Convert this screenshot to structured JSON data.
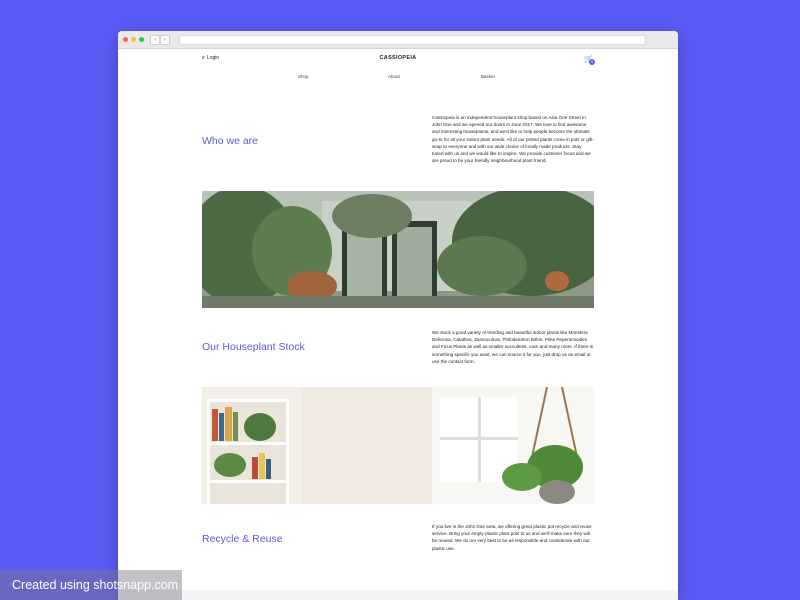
{
  "site": {
    "login_label": "Login",
    "login_icon": "hamburger-icon",
    "brand": "CASSIOPEIA",
    "cart_icon": "cart-icon",
    "cart_count": "0"
  },
  "nav": {
    "items": [
      {
        "label": "Shop"
      },
      {
        "label": "About"
      },
      {
        "label": "Basket"
      }
    ]
  },
  "sections": [
    {
      "heading": "Who we are",
      "text": "Cassiopeia is an independent houseplant shop based on Asia One Street in John Doe and we opened our doors in June 2017. We love to find awesome and interesting houseplants, and we'd like to help people become the ultimate go-to for all your indoor plant needs. All of our potted plants come in pots or gift-wrap to everyone and with our wide choice of locally made products. Stay tuned with us and we would like to inspire. We provide customer focus and we are proud to be your friendly neighbourhood plant friend."
    },
    {
      "heading": "Our Houseplant Stock",
      "text": "We stock a good variety of trending and beautiful indoor plants like Monstera Deliciosa, Calathea, Zamioculcas, Philodendron Birkin, Pilea Peperomioides and Ficus Plants as well as smaller succulents, cacti and many more. If there is something specific you want, we can source it for you, just drop us an email or use the contact form."
    },
    {
      "heading": "Recycle & Reuse",
      "text": "If you live in the John Doe area, we offering great plastic pot recycle and reuse service. Bring your empty plastic plant pots to us and we'll make sure they will be reused. We do our very best to be as responsible and considerate with our plastic use."
    }
  ],
  "watermark": "Created using shotsnapp.com",
  "colors": {
    "background": "#5b5cf6",
    "accent": "#5b5cd6",
    "page": "#ffffff"
  }
}
